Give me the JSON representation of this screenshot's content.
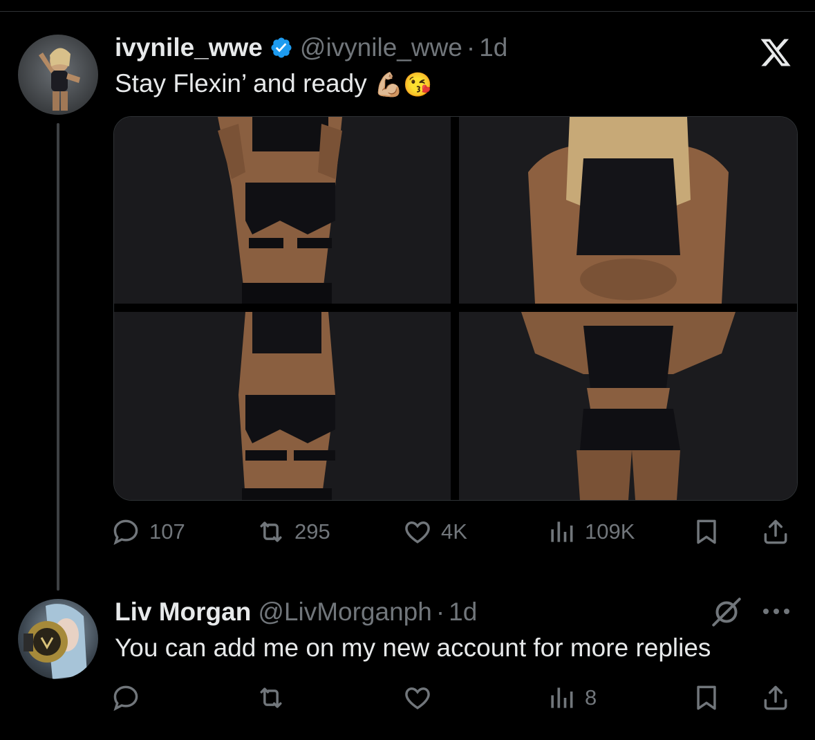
{
  "tweet": {
    "author_name": "ivynile_wwe",
    "author_handle": "@ivynile_wwe",
    "separator": "·",
    "time": "1d",
    "text": "Stay Flexin’ and ready",
    "emojis": [
      "💪🏼",
      "😘"
    ],
    "media_count": 4,
    "stats": {
      "replies": "107",
      "reposts": "295",
      "likes": "4K",
      "views": "109K"
    }
  },
  "reply": {
    "author_name": "Liv Morgan",
    "author_handle": "@LivMorganph",
    "separator": "·",
    "time": "1d",
    "text": "You can add me on my new account for more replies",
    "stats": {
      "views": "8"
    }
  },
  "icons": {
    "brand": "x-logo-icon",
    "verified": "verified-badge-icon",
    "reply": "reply-icon",
    "repost": "repost-icon",
    "like": "heart-icon",
    "views": "views-icon",
    "bookmark": "bookmark-icon",
    "share": "share-icon",
    "more": "more-icon",
    "grok": "grok-icon"
  },
  "colors": {
    "background": "#000000",
    "text": "#e7e9ea",
    "muted": "#71767b",
    "verified": "#1d9bf0"
  }
}
